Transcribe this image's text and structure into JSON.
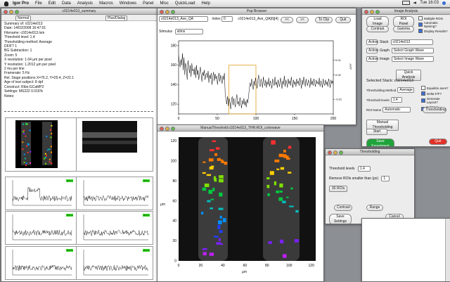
{
  "menubar": {
    "items": [
      "Igor Pro",
      "File",
      "Edit",
      "Data",
      "Analysis",
      "Macros",
      "Windows",
      "Panel",
      "Misc",
      "QuickLoad",
      "Help"
    ],
    "clock": "Tue 16:03"
  },
  "summary_window": {
    "title": "c0214e013_summary",
    "toolbar_tabs": [
      "Normal",
      "Plus/Dialog"
    ],
    "lines": [
      "Summary of: c0214e013",
      "Date: 14/02/2008 16:47:01",
      "Filename: c0214e013.lsm",
      "Threshold level: 1.4",
      "Thresholding method: Average",
      "DF/F? 1",
      "BG Subtraction: 1",
      "Zoom: 5",
      "X resolution: 1.04 µm per pixel",
      "Y resolution: 1.2012 µm per pixel",
      "2 ms per line",
      "Framerate: 5 Hz",
      "Rel. Stage positions X=76.2, Y=25.4, Z=22.1",
      "Age of test subject: 8 dpf",
      "Construct: Ribo:GCaMP2",
      "Settings: MS222 0.016%",
      "Notes:"
    ],
    "tags": [
      "ROI 1",
      "ROI 2",
      "ROI 3",
      "ROI 4",
      "ROI 5",
      "ROI 6"
    ]
  },
  "pop_browser": {
    "title": "Pop Browser",
    "wave_select": "c0214e013_Ave_QA",
    "index_label": "Index",
    "index_value": "0",
    "wave_name_text": "c0214e013_Ave_QA[6][4]",
    "prev_button": "<<",
    "next_button": ">>",
    "toclip_button": "To Clip",
    "quit_button": "Quit",
    "stimulus_label": "Stimulus",
    "stimulus_value": "stims",
    "right_axis_label": "ΔF/F"
  },
  "threshold_image": {
    "title": "ManualThreshold:c0214e013_THR:ROI_colorwave",
    "xlabel": "µm",
    "ylabel": "µm",
    "xticks": [
      "0",
      "20",
      "40",
      "60",
      "80",
      "100",
      "120"
    ],
    "yticks": [
      "0",
      "20",
      "40",
      "60",
      "80",
      "100",
      "120"
    ]
  },
  "thresholding_dialog": {
    "title": "Thresholding",
    "threshold_label": "Threshold levels",
    "threshold_value": "1.4",
    "remove_label": "Remove ROIs smaller than (px)",
    "remove_value": "1",
    "roi_count": "90 ROIs",
    "contrast_button": "Contrast",
    "range_button": "Range",
    "save_settings_button": "Save Settings",
    "cancel_button": "Cancel"
  },
  "image_analysis": {
    "title": "Image Analysis",
    "load_image": "Load Image",
    "roi_panel": "ROI Panel",
    "contrast": "Contrast",
    "gamma": "Gamma",
    "checks": [
      "Multiple ROIs",
      "Automatic Naming?",
      "Display Results?"
    ],
    "action_label": "Action",
    "stack_label": "Stack",
    "stack_value": "c0214e013",
    "graph_label": "Graph",
    "graph_value": "Select Graph Wave",
    "image_label": "Image",
    "image_value": "Select Image Wave",
    "quick_analysis": "Quick Analysis",
    "selected_stack_label": "Selected Stack:",
    "selected_stack_value": "c0214e013",
    "method_label": "Thresholding Method",
    "method_value": "Average",
    "threshold_levels_label": "Threshold levels",
    "threshold_levels_value": "1.4",
    "roi_name_label": "ROI Name",
    "roi_name_value": "Automatic",
    "thresholding_button": "Thresholding",
    "manual_threshold_button": "Manual Thresholding",
    "start_button": "Start",
    "right_checks": [
      "Equalize axes?",
      "Delta F/F?",
      "Generate Layout?",
      "Subtract Background?"
    ],
    "save_experiment": "Save Experiment",
    "quit": "Quit"
  },
  "chart_data": {
    "type": "line",
    "title": "",
    "xlabel": "",
    "ylabel": "",
    "xlim": [
      0,
      200
    ],
    "ylim": [
      110,
      185
    ],
    "xticks": [
      0,
      50,
      100,
      150,
      200
    ],
    "yticks": [
      120,
      140,
      160,
      180
    ],
    "right_axis_ticks": [
      0.01,
      0.02,
      -0.01
    ],
    "stimulus_window": [
      65,
      100
    ],
    "series": [
      {
        "values": [
          170,
          163,
          158,
          166,
          160,
          172,
          155,
          168,
          150,
          162,
          157,
          145,
          165,
          158,
          152,
          160,
          148,
          162,
          154,
          156,
          150,
          158,
          147,
          160,
          150,
          155,
          145,
          152,
          158,
          150,
          143,
          153,
          149,
          155,
          145,
          150,
          152,
          147,
          154,
          142,
          150,
          146,
          152,
          140,
          148,
          153,
          144,
          151,
          146,
          149,
          140,
          147,
          152,
          143,
          150,
          146,
          141,
          149,
          145,
          152,
          130,
          125,
          120,
          128,
          118,
          126,
          122,
          115,
          124,
          128,
          119,
          126,
          121,
          117,
          125,
          130,
          120,
          123,
          118,
          127,
          122,
          116,
          124,
          120,
          126,
          119,
          123,
          117,
          125,
          121,
          128,
          136,
          142,
          138,
          146,
          140,
          135,
          144,
          139,
          147,
          141,
          136,
          145,
          150,
          140,
          138,
          146,
          142,
          137,
          148,
          141,
          139,
          145,
          137,
          143,
          140,
          147,
          138,
          144,
          141,
          136,
          146,
          142,
          139,
          148,
          140,
          143,
          137,
          145,
          141,
          138,
          147,
          143,
          136,
          144,
          140,
          149,
          138,
          145,
          142,
          137,
          146,
          141,
          144,
          139,
          148,
          142,
          137,
          145,
          140,
          143,
          138,
          146,
          141,
          144,
          139,
          147,
          142,
          136,
          145,
          140,
          148,
          143,
          138,
          146,
          141,
          139,
          145,
          142,
          137,
          147,
          140,
          144,
          139,
          146,
          142,
          138,
          145,
          141,
          143,
          140,
          147,
          138,
          144,
          142,
          137,
          146,
          141,
          139,
          145,
          140,
          143,
          138,
          146,
          142,
          137,
          145,
          141,
          144,
          140
        ]
      }
    ]
  }
}
